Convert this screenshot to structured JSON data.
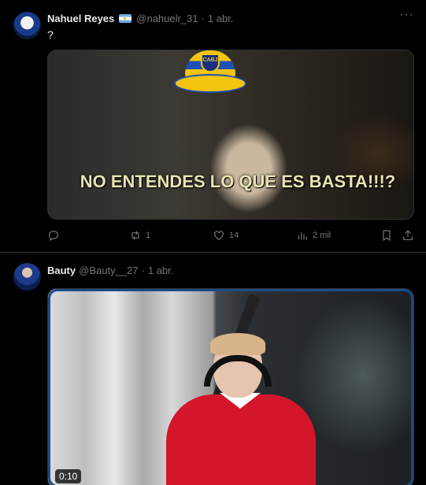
{
  "tweets": [
    {
      "author": {
        "name": "Nahuel Reyes",
        "flag": "argentina-flag",
        "handle": "@nahuelr_31",
        "separator": "·",
        "date": "1 abr."
      },
      "text": "?",
      "media": {
        "type": "image",
        "caption": "NO ENTENDES LO QUE ES BASTA!!!?",
        "hat_badge": "CABJ"
      },
      "actions": {
        "reply": {
          "icon": "reply-icon",
          "count": ""
        },
        "retweet": {
          "icon": "retweet-icon",
          "count": "1"
        },
        "like": {
          "icon": "heart-icon",
          "count": "14"
        },
        "views": {
          "icon": "views-icon",
          "count": "2 mil"
        },
        "bookmark": {
          "icon": "bookmark-icon"
        },
        "share": {
          "icon": "share-icon"
        }
      },
      "more_icon": "more-icon"
    },
    {
      "author": {
        "name": "Bauty",
        "handle": "@Bauty__27",
        "separator": "·",
        "date": "1 abr."
      },
      "media": {
        "type": "video",
        "duration": "0:10"
      },
      "more_icon": "more-icon"
    }
  ],
  "colors": {
    "background": "#000000",
    "text": "#e7e9ea",
    "muted": "#71767b",
    "border": "#2f3336"
  }
}
